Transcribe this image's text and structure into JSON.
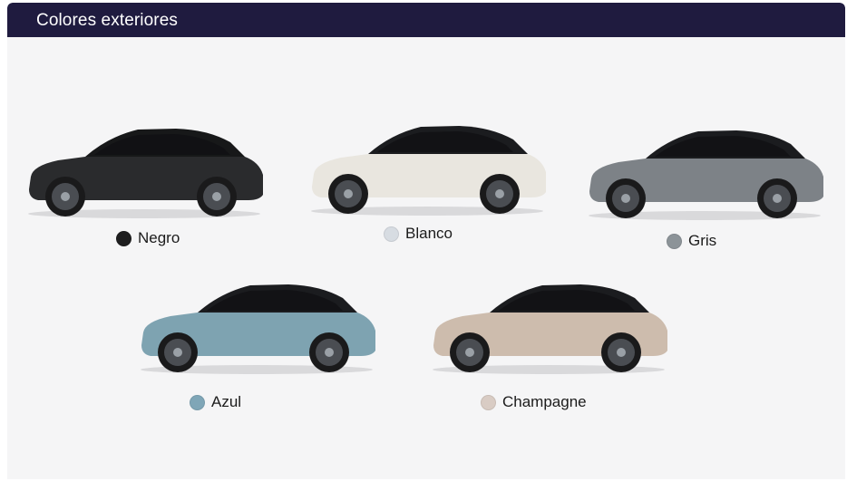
{
  "header": {
    "title": "Colores exteriores"
  },
  "colors": [
    {
      "label": "Negro",
      "icon": "car-icon",
      "swatch": "#1e1e1f",
      "body": "#2a2b2d",
      "roof": "#171819"
    },
    {
      "label": "Blanco",
      "icon": "car-icon",
      "swatch": "#d7dce2",
      "body": "#e9e6df",
      "roof": "#1b1c1f"
    },
    {
      "label": "Gris",
      "icon": "car-icon",
      "swatch": "#8c9398",
      "body": "#7d8287",
      "roof": "#1b1c1f"
    },
    {
      "label": "Azul",
      "icon": "car-icon",
      "swatch": "#7fa6b7",
      "body": "#7ea3b1",
      "roof": "#1b1c1f"
    },
    {
      "label": "Champagne",
      "icon": "car-icon",
      "swatch": "#d9ccc4",
      "body": "#cdbcad",
      "roof": "#1b1c1f"
    }
  ]
}
